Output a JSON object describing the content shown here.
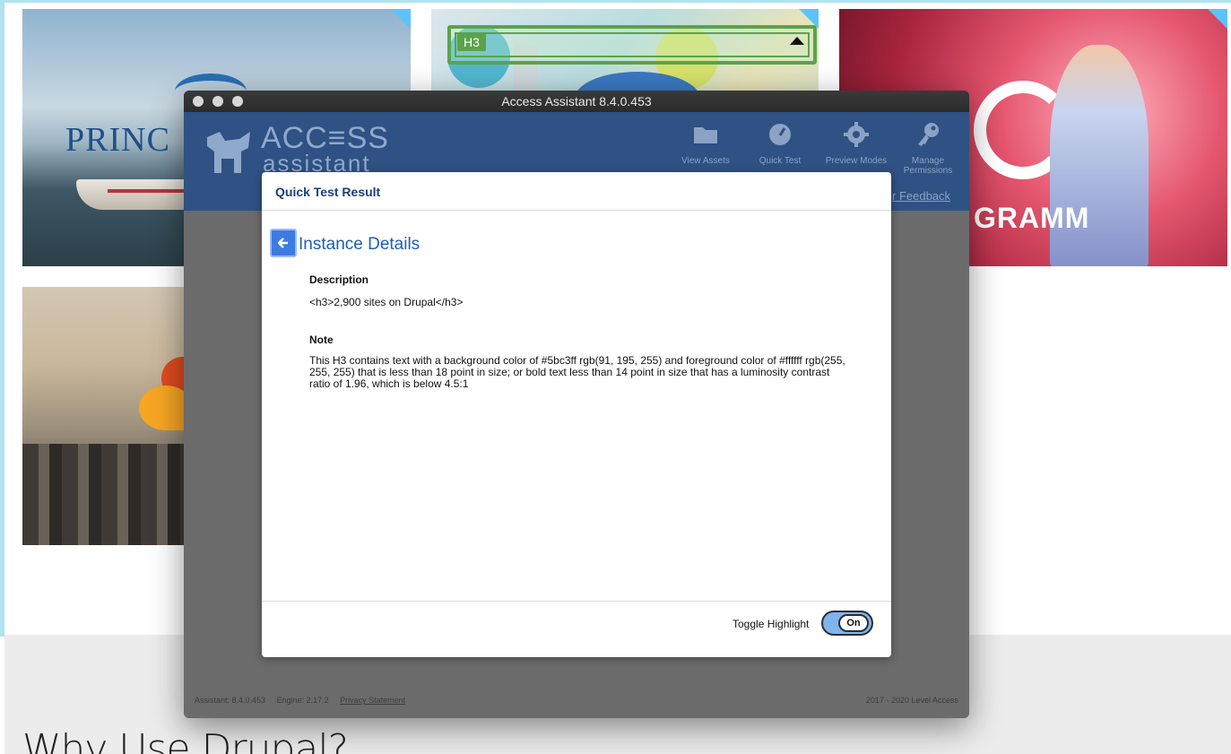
{
  "background_page": {
    "tiles": {
      "princess_logo": "PRINC",
      "grammy_logo": "GRAMM"
    },
    "highlight_tag": "H3",
    "section_heading": "Why Use Drupal?"
  },
  "window": {
    "title": "Access Assistant 8.4.0.453"
  },
  "brand": {
    "line1": "ACC≡SS",
    "line2": "assistant"
  },
  "nav": {
    "view_assets": "View Assets",
    "quick_test": "Quick Test",
    "preview_modes": "Preview Modes",
    "manage_permissions": "Manage Permissions",
    "feedback": "r Feedback"
  },
  "dialog": {
    "title": "Quick Test Result",
    "heading": "Instance Details",
    "description_label": "Description",
    "description_value": "<h3>2,900 sites on Drupal</h3>",
    "note_label": "Note",
    "note_value": "This H3 contains text with a background color of #5bc3ff rgb(91, 195, 255) and foreground color of #ffffff rgb(255, 255, 255) that is less than 18 point in size; or bold text less than 14 point in size that has a luminosity contrast ratio of 1.96, which is below 4.5:1",
    "toggle_label": "Toggle Highlight",
    "toggle_state": "On"
  },
  "footer": {
    "assistant_version": "Assistant: 8.4.0.453",
    "engine_version": "Engine: 2.17.2",
    "privacy": "Privacy Statement",
    "copyright": "2017 - 2020 Level Access"
  },
  "colors": {
    "header_blue": "#2f5183",
    "link_blue": "#1f5eb5",
    "highlight_green": "#5ba34b",
    "toggle_on": "#7fb5ee",
    "tile_corner": "#5bc3ff"
  },
  "icons": {
    "back": "arrow-left-icon",
    "view_assets": "folder-icon",
    "quick_test": "gauge-icon",
    "preview_modes": "gear-icon",
    "manage_permissions": "key-icon"
  }
}
